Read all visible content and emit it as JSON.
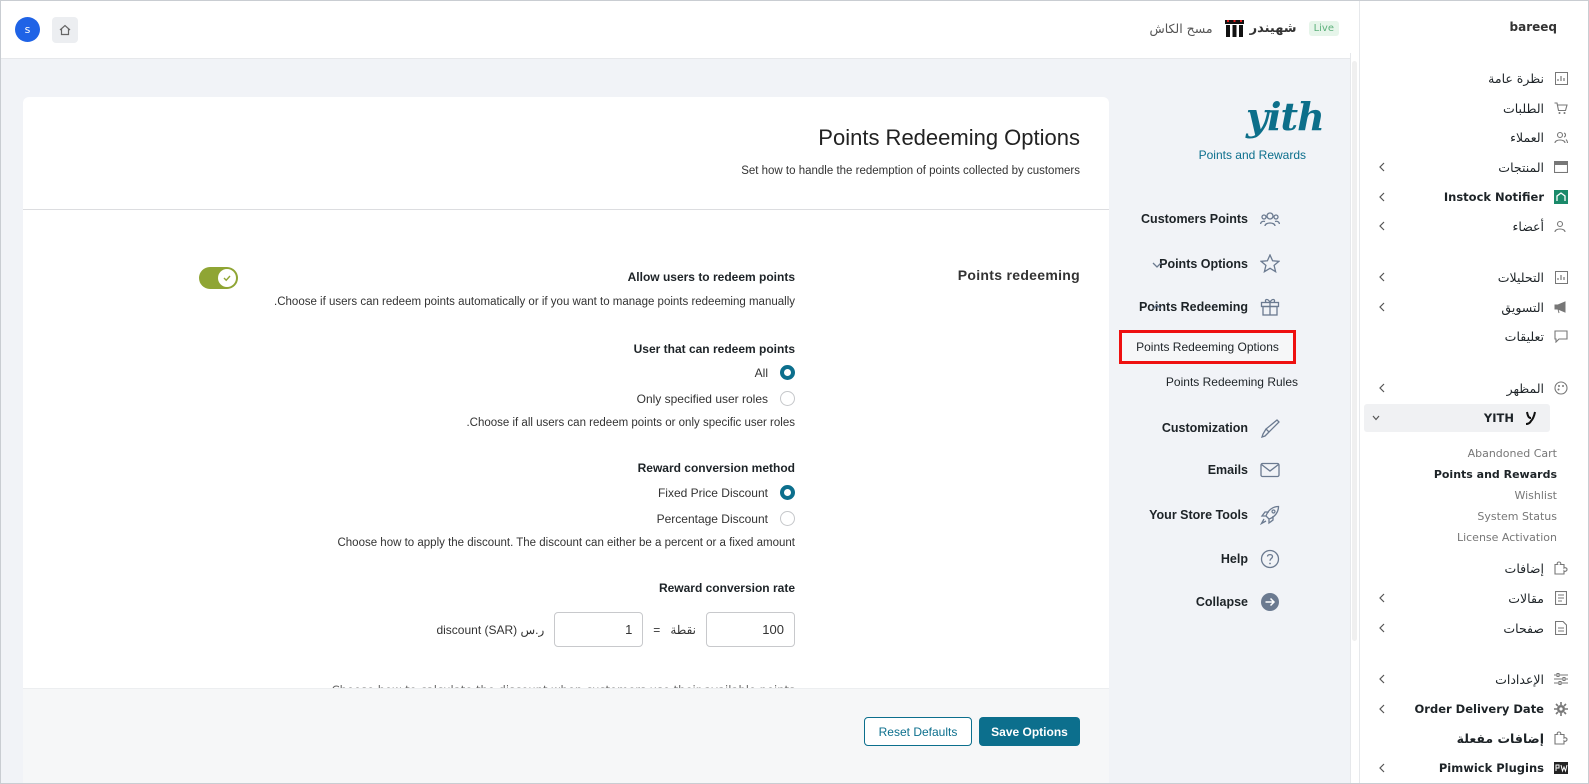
{
  "topbar": {
    "avatar_letter": "s",
    "live_badge": "Live",
    "shop_name": "شهيندر",
    "cash_scan": "مسح الكاش"
  },
  "sidebar": {
    "brand": "bareeq",
    "items": [
      {
        "label": "نظرة عامة",
        "icon": "chart-icon"
      },
      {
        "label": "الطلبات",
        "icon": "cart-icon"
      },
      {
        "label": "العملاء",
        "icon": "users-icon"
      },
      {
        "label": "المنتجات",
        "icon": "box-icon"
      },
      {
        "label": "Instock Notifier",
        "icon": "notifier-icon"
      },
      {
        "label": "أعضاء",
        "icon": "member-icon"
      },
      {
        "label": "التحليلات",
        "icon": "analytics-icon"
      },
      {
        "label": "التسويق",
        "icon": "megaphone-icon"
      },
      {
        "label": "تعليقات",
        "icon": "comment-icon"
      },
      {
        "label": "المظهر",
        "icon": "palette-icon"
      },
      {
        "label": "YITH",
        "icon": "yith-icon"
      },
      {
        "label": "إضافات",
        "icon": "plugin-icon"
      },
      {
        "label": "مقالات",
        "icon": "post-icon"
      },
      {
        "label": "صفحات",
        "icon": "page-icon"
      },
      {
        "label": "الإعدادات",
        "icon": "settings-icon"
      },
      {
        "label": "Order Delivery Date",
        "icon": "gear-icon"
      },
      {
        "label": "إضافات مفعلة",
        "icon": "plugin-icon"
      },
      {
        "label": "Pimwick Plugins",
        "icon": "pw-icon"
      }
    ],
    "yith_sub": [
      "Abandoned Cart",
      "Points and Rewards",
      "Wishlist",
      "System Status",
      "License Activation"
    ]
  },
  "plugin_nav": {
    "logo": "yith",
    "subtitle": "Points and Rewards",
    "items": [
      {
        "label": "Customers Points",
        "icon": "customers-icon"
      },
      {
        "label": "Points Options",
        "icon": "star-icon"
      },
      {
        "label": "Points Redeeming",
        "icon": "gift-icon"
      },
      {
        "label": "Customization",
        "icon": "brush-icon"
      },
      {
        "label": "Emails",
        "icon": "mail-icon"
      },
      {
        "label": "Your Store Tools",
        "icon": "rocket-icon"
      },
      {
        "label": "Help",
        "icon": "help-icon"
      },
      {
        "label": "Collapse",
        "icon": "collapse-icon"
      }
    ],
    "sub_items": [
      "Points Redeeming Options",
      "Points Redeeming Rules"
    ]
  },
  "main": {
    "title": "Points Redeeming Options",
    "subtitle": "Set how to handle the redemption of points collected by customers",
    "section": "Points redeeming",
    "allow_label": "Allow users to redeem points",
    "allow_desc": "Choose if users can redeem points automatically or if you want to manage points redeeming manually.",
    "allow_enabled": true,
    "user_label": "User that can redeem points",
    "user_options": [
      "All",
      "Only specified user roles"
    ],
    "user_selected": "All",
    "user_desc": "Choose if all users can redeem points or only specific user roles.",
    "method_label": "Reward conversion method",
    "method_options": [
      "Fixed Price Discount",
      "Percentage Discount"
    ],
    "method_selected": "Fixed Price Discount",
    "method_desc": "Choose how to apply the discount. The discount can either be a percent or a fixed amount",
    "rate_label": "Reward conversion rate",
    "rate_points": "100",
    "rate_points_unit": "نقطة",
    "rate_equals": "=",
    "rate_discount": "1",
    "rate_discount_unit": "ر.س discount (SAR)",
    "cut_desc": "Choose how to calculate the discount when customers use their available points"
  },
  "footer": {
    "reset_label": "Reset Defaults",
    "save_label": "Save Options"
  }
}
